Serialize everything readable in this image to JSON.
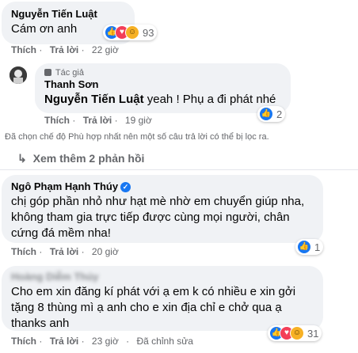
{
  "comments": {
    "c1": {
      "author": "Nguyễn Tiến Luật",
      "text": "Cám ơn anh",
      "reaction_count": "93",
      "like": "Thích",
      "reply": "Trả lời",
      "time": "22 giờ"
    },
    "reply1": {
      "badge": "Tác giả",
      "author": "Thanh Sơn",
      "mention": "Nguyễn Tiến Luật",
      "text": " yeah ! Phụ a đi phát nhé",
      "reaction_count": "2",
      "like": "Thích",
      "reply": "Trả lời",
      "time": "19 giờ"
    },
    "filter_note": "Đã chọn chế độ Phù hợp nhất nên một số câu trả lời có thể bị lọc ra.",
    "see_more": "Xem thêm 2 phản hồi",
    "c2": {
      "author": "Ngô Phạm Hạnh Thúy",
      "text": "chị góp phần nhỏ như hạt mè nhờ em chuyển giúp nha, không tham gia trực tiếp được cùng mọi người, chân cứng đá mềm nha!",
      "reaction_count": "1",
      "like": "Thích",
      "reply": "Trả lời",
      "time": "20 giờ"
    },
    "c3": {
      "author": "Hoàng Diễm Thúy",
      "text": "Cho em xin đăng kí phát với ạ em k có nhiều e xin gởi tặng 8 thùng mì ạ anh cho e xin địa chỉ e chở qua ạ thanks anh",
      "reaction_count": "31",
      "like": "Thích",
      "reply": "Trả lời",
      "time": "23 giờ",
      "edited": "Đã chỉnh sửa"
    }
  },
  "colors": {
    "bubble": "#f0f2f5",
    "meta": "#65676b",
    "like": "#1877f2",
    "love": "#f33e58",
    "haha": "#f7b125"
  },
  "icons": [
    "like-icon",
    "love-icon",
    "haha-icon",
    "author-badge-icon",
    "verified-icon",
    "chevron-right-icon"
  ]
}
